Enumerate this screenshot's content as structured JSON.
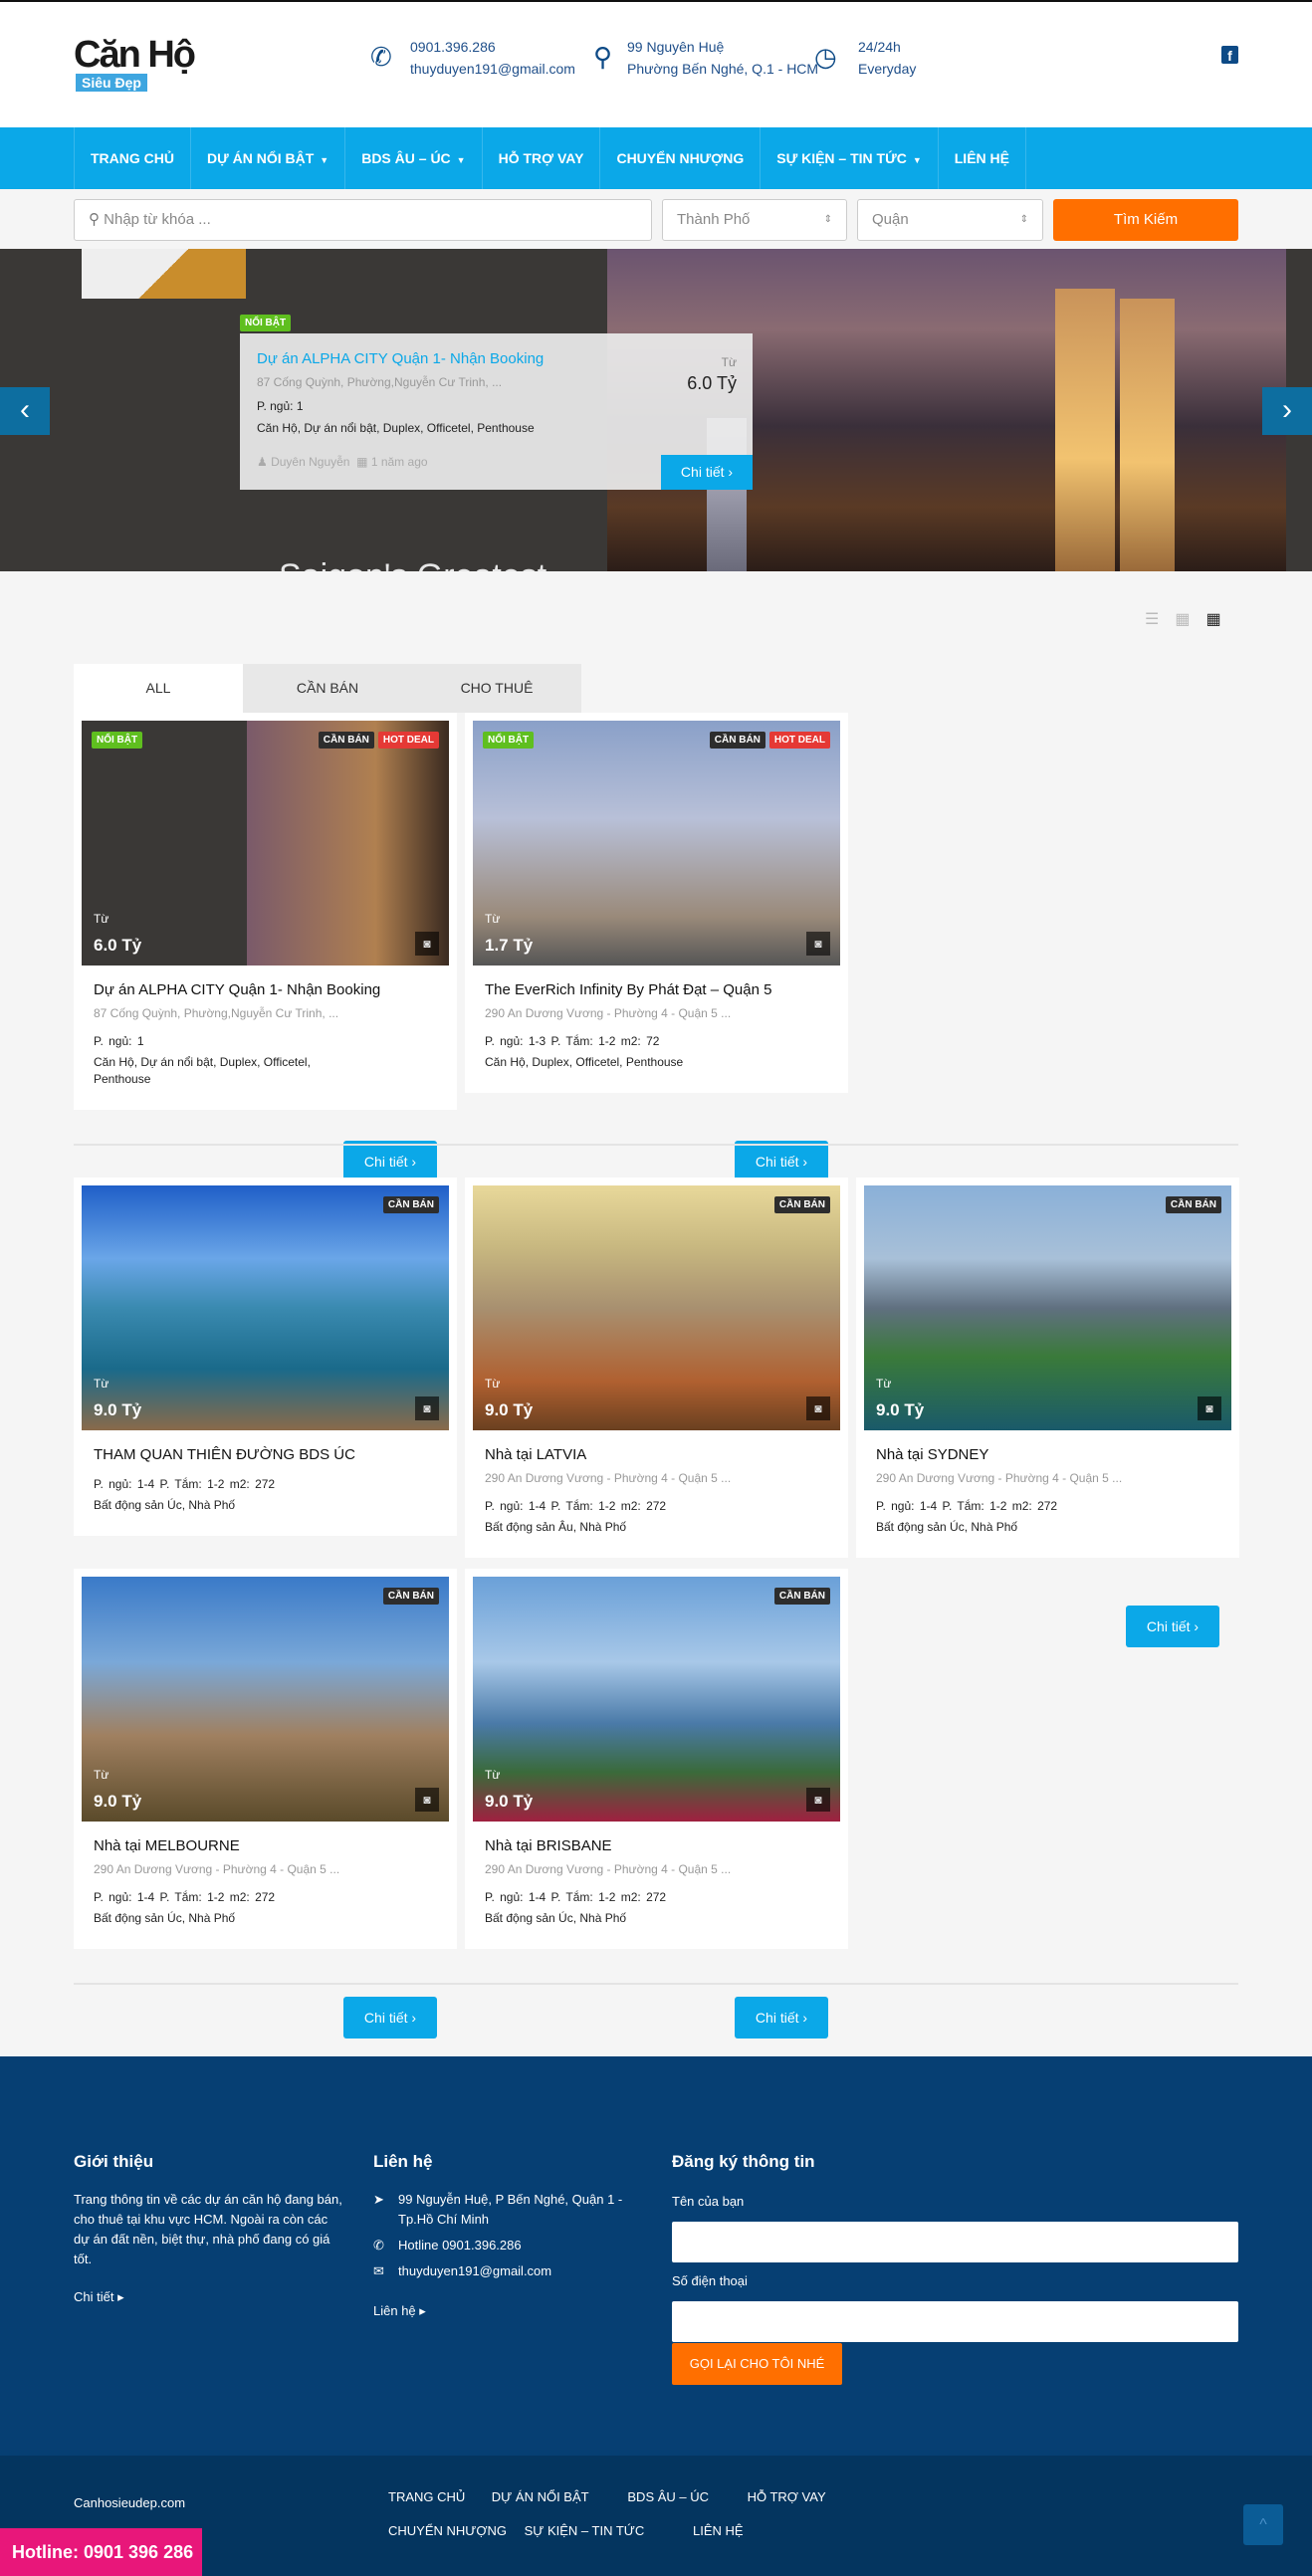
{
  "header": {
    "logo_main": "Căn Hộ",
    "logo_sub": "Siêu Đẹp",
    "phone": "0901.396.286",
    "email": "thuyduyen191@gmail.com",
    "address_line1": "99 Nguyên Huệ",
    "address_line2": "Phường Bến Nghé, Q.1 - HCM",
    "hours_line1": "24/24h",
    "hours_line2": "Everyday"
  },
  "nav": [
    {
      "label": "TRANG CHỦ",
      "dropdown": false
    },
    {
      "label": "DỰ ÁN NỔI BẬT",
      "dropdown": true
    },
    {
      "label": "BDS ÂU – ÚC",
      "dropdown": true
    },
    {
      "label": "HỖ TRỢ VAY",
      "dropdown": false
    },
    {
      "label": "CHUYỂN NHƯỢNG",
      "dropdown": false
    },
    {
      "label": "SỰ KIỆN – TIN TỨC",
      "dropdown": true
    },
    {
      "label": "LIÊN HỆ",
      "dropdown": false
    }
  ],
  "search": {
    "placeholder": "Nhập từ khóa ...",
    "city": "Thành Phố",
    "district": "Quận",
    "button": "Tìm Kiếm"
  },
  "hero": {
    "badge": "NỔI BẬT",
    "title": "Dự án ALPHA CITY Quận 1- Nhận Booking",
    "address": "87 Cống Quỳnh, Phường,Nguyễn Cư Trinh, ...",
    "specs": "P. ngủ: 1",
    "categories": "Căn Hộ, Dự án nổi bật, Duplex, Officetel, Penthouse",
    "author": "Duyên Nguyễn",
    "date": "1 năm ago",
    "from": "Từ",
    "price": "6.0 Tỷ",
    "button": "Chi tiết",
    "tagline": "Saigon's Greatest Neighborhood"
  },
  "tabs": [
    "ALL",
    "CẦN BÁN",
    "CHO THUÊ"
  ],
  "cards": [
    {
      "title": "Dự án ALPHA CITY Quận 1- Nhận Booking",
      "address": "87 Cống Quỳnh, Phường,Nguyễn Cư Trinh, ...",
      "specs": "P. ngủ: 1",
      "categories": "Căn Hộ, Dự án nổi bật, Duplex, Officetel, Penthouse",
      "from": "Từ",
      "price": "6.0 Tỷ",
      "featured": "NỔI BẬT",
      "status": "CẦN BÁN",
      "deal": "HOT DEAL",
      "button": "Chi tiết"
    },
    {
      "title": "The EverRich Infinity By Phát Đạt – Quận 5",
      "address": "290 An Dương Vương - Phường 4 - Quận 5 ...",
      "specs": "P. ngủ: 1-3  P. Tắm: 1-2  m2: 72",
      "categories": "Căn Hộ, Duplex, Officetel, Penthouse",
      "from": "Từ",
      "price": "1.7 Tỷ",
      "featured": "NỔI BẬT",
      "status": "CẦN BÁN",
      "deal": "HOT DEAL",
      "button": "Chi tiết"
    },
    {
      "title": "THAM QUAN THIÊN ĐƯỜNG BDS ÚC",
      "address": "",
      "specs": "P. ngủ: 1-4  P. Tắm: 1-2  m2: 272",
      "categories": "Bất động sản Úc, Nhà Phố",
      "from": "Từ",
      "price": "9.0 Tỷ",
      "status": "CẦN BÁN",
      "button": "Chi tiết"
    },
    {
      "title": "Nhà tại LATVIA",
      "address": "290 An Dương Vương - Phường 4 - Quận 5 ...",
      "specs": "P. ngủ: 1-4  P. Tắm: 1-2  m2: 272",
      "categories": "Bất động sản Âu, Nhà Phố",
      "from": "Từ",
      "price": "9.0 Tỷ",
      "status": "CẦN BÁN",
      "button": "Chi tiết"
    },
    {
      "title": "Nhà tại SYDNEY",
      "address": "290 An Dương Vương - Phường 4 - Quận 5 ...",
      "specs": "P. ngủ: 1-4  P. Tắm: 1-2  m2: 272",
      "categories": "Bất động sản Úc, Nhà Phố",
      "from": "Từ",
      "price": "9.0 Tỷ",
      "status": "CẦN BÁN",
      "button": "Chi tiết"
    },
    {
      "title": "Nhà tại MELBOURNE",
      "address": "290 An Dương Vương - Phường 4 - Quận 5 ...",
      "specs": "P. ngủ: 1-4  P. Tắm: 1-2  m2: 272",
      "categories": "Bất động sản Úc, Nhà Phố",
      "from": "Từ",
      "price": "9.0 Tỷ",
      "status": "CẦN BÁN",
      "button": "Chi tiết"
    },
    {
      "title": "Nhà tại BRISBANE",
      "address": "290 An Dương Vương - Phường 4 - Quận 5 ...",
      "specs": "P. ngủ: 1-4  P. Tắm: 1-2  m2: 272",
      "categories": "Bất động sản Úc, Nhà Phố",
      "from": "Từ",
      "price": "9.0 Tỷ",
      "status": "CẦN BÁN",
      "button": "Chi tiết"
    }
  ],
  "footer": {
    "about_title": "Giới thiệu",
    "about_text": "Trang thông tin về các dự án căn hộ đang bán, cho thuê tại khu vực HCM. Ngoài ra còn các dự án đất nền, biệt thự, nhà phố đang có giá tốt.",
    "about_link": "Chi tiết",
    "contact_title": "Liên hệ",
    "contact_address": "99 Nguyễn Huệ, P Bến Nghé, Quận 1 - Tp.Hồ Chí Minh",
    "contact_hotline": "Hotline 0901.396.286",
    "contact_email": "thuyduyen191@gmail.com",
    "contact_link": "Liên hệ",
    "signup_title": "Đăng ký thông tin",
    "name_label": "Tên của bạn",
    "phone_label": "Số điện thoại",
    "submit": "GỌI LẠI CHO TÔI NHÉ"
  },
  "bottom": {
    "site": "Canhosieudep.com",
    "links_row1": [
      "TRANG CHỦ",
      "DỰ ÁN NỔI BẬT",
      "BDS ÂU – ÚC",
      "HỖ TRỢ VAY"
    ],
    "links_row2": [
      "CHUYỂN NHƯỢNG",
      "SỰ KIỆN – TIN TỨC",
      "LIÊN HỆ"
    ],
    "hotline": "Hotline: 0901 396 286"
  },
  "colors": {
    "nav": "#0ba8e8",
    "accent_orange": "#ff6f00",
    "footer": "#063f73",
    "hotline": "#e8177a"
  }
}
